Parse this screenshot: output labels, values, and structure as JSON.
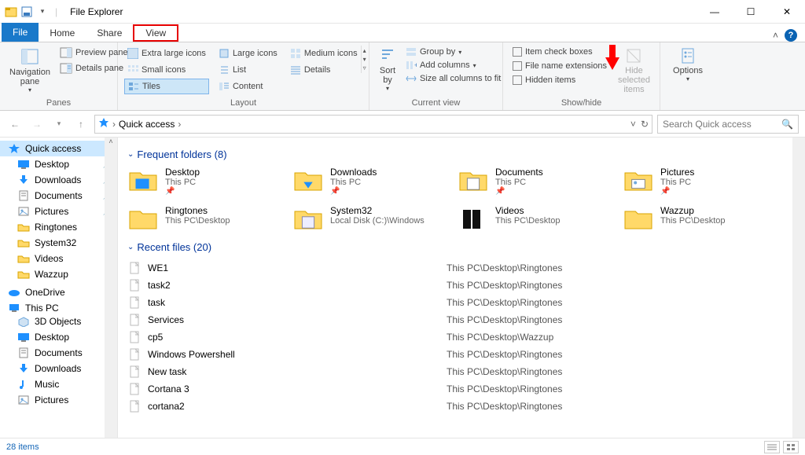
{
  "window": {
    "title": "File Explorer"
  },
  "tabs": {
    "file": "File",
    "home": "Home",
    "share": "Share",
    "view": "View"
  },
  "ribbon": {
    "panes": {
      "nav": "Navigation pane",
      "preview": "Preview pane",
      "details": "Details pane",
      "group": "Panes"
    },
    "layout": {
      "extra_large": "Extra large icons",
      "large": "Large icons",
      "medium": "Medium icons",
      "small": "Small icons",
      "list": "List",
      "details": "Details",
      "tiles": "Tiles",
      "content": "Content",
      "group": "Layout"
    },
    "current": {
      "sort": "Sort by",
      "group_by": "Group by",
      "add_columns": "Add columns",
      "size_all": "Size all columns to fit",
      "group": "Current view"
    },
    "showhide": {
      "item_check": "Item check boxes",
      "file_ext": "File name extensions",
      "hidden": "Hidden items",
      "hide_sel": "Hide selected items",
      "group": "Show/hide"
    },
    "options": "Options"
  },
  "address": {
    "path": "Quick access",
    "crumb_sep": "›"
  },
  "search": {
    "placeholder": "Search Quick access"
  },
  "sidebar": {
    "quick_access": "Quick access",
    "items": [
      {
        "label": "Desktop",
        "pinned": true,
        "icon": "desktop"
      },
      {
        "label": "Downloads",
        "pinned": true,
        "icon": "downloads"
      },
      {
        "label": "Documents",
        "pinned": true,
        "icon": "documents"
      },
      {
        "label": "Pictures",
        "pinned": true,
        "icon": "pictures"
      },
      {
        "label": "Ringtones",
        "pinned": false,
        "icon": "folder"
      },
      {
        "label": "System32",
        "pinned": false,
        "icon": "folder"
      },
      {
        "label": "Videos",
        "pinned": false,
        "icon": "folder"
      },
      {
        "label": "Wazzup",
        "pinned": false,
        "icon": "folder"
      }
    ],
    "onedrive": "OneDrive",
    "thispc": "This PC",
    "pc_items": [
      {
        "label": "3D Objects",
        "icon": "3d"
      },
      {
        "label": "Desktop",
        "icon": "desktop"
      },
      {
        "label": "Documents",
        "icon": "documents"
      },
      {
        "label": "Downloads",
        "icon": "downloads"
      },
      {
        "label": "Music",
        "icon": "music"
      },
      {
        "label": "Pictures",
        "icon": "pictures"
      }
    ]
  },
  "content": {
    "freq_header": "Frequent folders (8)",
    "freq": [
      {
        "name": "Desktop",
        "sub": "This PC",
        "pin": true,
        "icon": "desktop-folder"
      },
      {
        "name": "Downloads",
        "sub": "This PC",
        "pin": true,
        "icon": "downloads-folder"
      },
      {
        "name": "Documents",
        "sub": "This PC",
        "pin": true,
        "icon": "documents-folder"
      },
      {
        "name": "Pictures",
        "sub": "This PC",
        "pin": true,
        "icon": "pictures-folder"
      },
      {
        "name": "Ringtones",
        "sub": "This PC\\Desktop",
        "pin": false,
        "icon": "folder"
      },
      {
        "name": "System32",
        "sub": "Local Disk (C:)\\Windows",
        "pin": false,
        "icon": "sysfolder"
      },
      {
        "name": "Videos",
        "sub": "This PC\\Desktop",
        "pin": false,
        "icon": "videos-folder"
      },
      {
        "name": "Wazzup",
        "sub": "This PC\\Desktop",
        "pin": false,
        "icon": "folder"
      }
    ],
    "recent_header": "Recent files (20)",
    "recent": [
      {
        "name": "WE1",
        "loc": "This PC\\Desktop\\Ringtones"
      },
      {
        "name": "task2",
        "loc": "This PC\\Desktop\\Ringtones"
      },
      {
        "name": "task",
        "loc": "This PC\\Desktop\\Ringtones"
      },
      {
        "name": "Services",
        "loc": "This PC\\Desktop\\Ringtones"
      },
      {
        "name": "cp5",
        "loc": "This PC\\Desktop\\Wazzup"
      },
      {
        "name": "Windows Powershell",
        "loc": "This PC\\Desktop\\Ringtones"
      },
      {
        "name": "New task",
        "loc": "This PC\\Desktop\\Ringtones"
      },
      {
        "name": "Cortana 3",
        "loc": "This PC\\Desktop\\Ringtones"
      },
      {
        "name": "cortana2",
        "loc": "This PC\\Desktop\\Ringtones"
      }
    ]
  },
  "status": {
    "text": "28 items"
  }
}
